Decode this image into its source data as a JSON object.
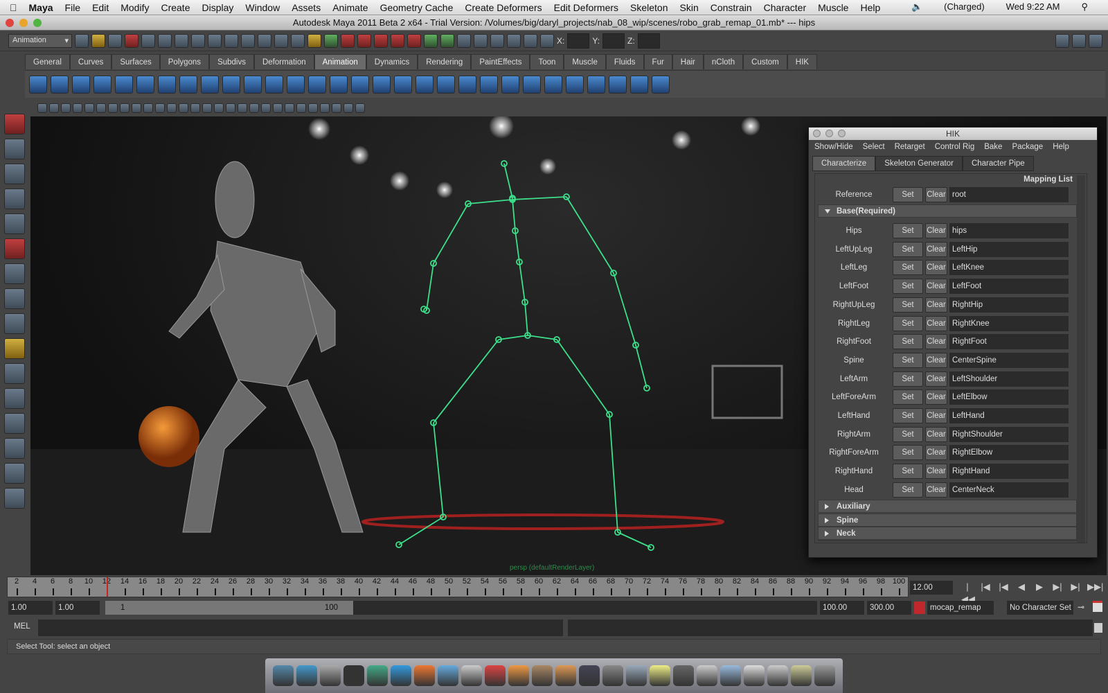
{
  "menubar": {
    "app": "Maya",
    "items": [
      "File",
      "Edit",
      "Modify",
      "Create",
      "Display",
      "Window",
      "Assets",
      "Animate",
      "Geometry Cache",
      "Create Deformers",
      "Edit Deformers",
      "Skeleton",
      "Skin",
      "Constrain",
      "Character",
      "Muscle",
      "Help"
    ],
    "battery": "(Charged)",
    "clock": "Wed 9:22 AM"
  },
  "window": {
    "title": "Autodesk Maya 2011 Beta 2 x64 - Trial Version: /Volumes/big/daryl_projects/nab_08_wip/scenes/robo_grab_remap_01.mb*  ---  hips"
  },
  "statusline": {
    "menu_set": "Animation",
    "x_label": "X:",
    "y_label": "Y:",
    "z_label": "Z:"
  },
  "shelf": {
    "tabs": [
      "General",
      "Curves",
      "Surfaces",
      "Polygons",
      "Subdivs",
      "Deformation",
      "Animation",
      "Dynamics",
      "Rendering",
      "PaintEffects",
      "Toon",
      "Muscle",
      "Fluids",
      "Fur",
      "Hair",
      "nCloth",
      "Custom",
      "HIK"
    ],
    "active": "Animation"
  },
  "viewport": {
    "camera_label": "persp (defaultRenderLayer)",
    "skeleton_color": "#3de08a"
  },
  "hik": {
    "title": "HIK",
    "menu": [
      "Show/Hide",
      "Select",
      "Retarget",
      "Control Rig",
      "Bake",
      "Package",
      "Help"
    ],
    "tabs": [
      "Characterize",
      "Skeleton Generator",
      "Character Pipe"
    ],
    "mapping_list": "Mapping List",
    "set_label": "Set",
    "clear_label": "Clear",
    "reference": {
      "label": "Reference",
      "value": "root"
    },
    "base_section": "Base(Required)",
    "rows": [
      {
        "label": "Hips",
        "value": "hips"
      },
      {
        "label": "LeftUpLeg",
        "value": "LeftHip"
      },
      {
        "label": "LeftLeg",
        "value": "LeftKnee"
      },
      {
        "label": "LeftFoot",
        "value": "LeftFoot"
      },
      {
        "label": "RightUpLeg",
        "value": "RightHip"
      },
      {
        "label": "RightLeg",
        "value": "RightKnee"
      },
      {
        "label": "RightFoot",
        "value": "RightFoot"
      },
      {
        "label": "Spine",
        "value": "CenterSpine"
      },
      {
        "label": "LeftArm",
        "value": "LeftShoulder"
      },
      {
        "label": "LeftForeArm",
        "value": "LeftElbow"
      },
      {
        "label": "LeftHand",
        "value": "LeftHand"
      },
      {
        "label": "RightArm",
        "value": "RightShoulder"
      },
      {
        "label": "RightForeArm",
        "value": "RightElbow"
      },
      {
        "label": "RightHand",
        "value": "RightHand"
      },
      {
        "label": "Head",
        "value": "CenterNeck"
      }
    ],
    "collapsed_sections": [
      "Auxiliary",
      "Spine",
      "Neck"
    ]
  },
  "timeline": {
    "ticks": [
      2,
      4,
      6,
      8,
      10,
      12,
      14,
      16,
      18,
      20,
      22,
      24,
      26,
      28,
      30,
      32,
      34,
      36,
      38,
      40,
      42,
      44,
      46,
      48,
      50,
      52,
      54,
      56,
      58,
      60,
      62,
      64,
      66,
      68,
      70,
      72,
      74,
      76,
      78,
      80,
      82,
      84,
      86,
      88,
      90,
      92,
      94,
      96,
      98,
      100
    ],
    "current_time": "12.00"
  },
  "range": {
    "start_time": "1.00",
    "playback_start": "1.00",
    "slider_start": "1",
    "slider_end": "100",
    "playback_end": "100.00",
    "end_time": "300.00",
    "anim_layer": "mocap_remap",
    "character_set": "No Character Set"
  },
  "commandline": {
    "label": "MEL"
  },
  "helpline": {
    "text": "Select Tool: select an object"
  }
}
